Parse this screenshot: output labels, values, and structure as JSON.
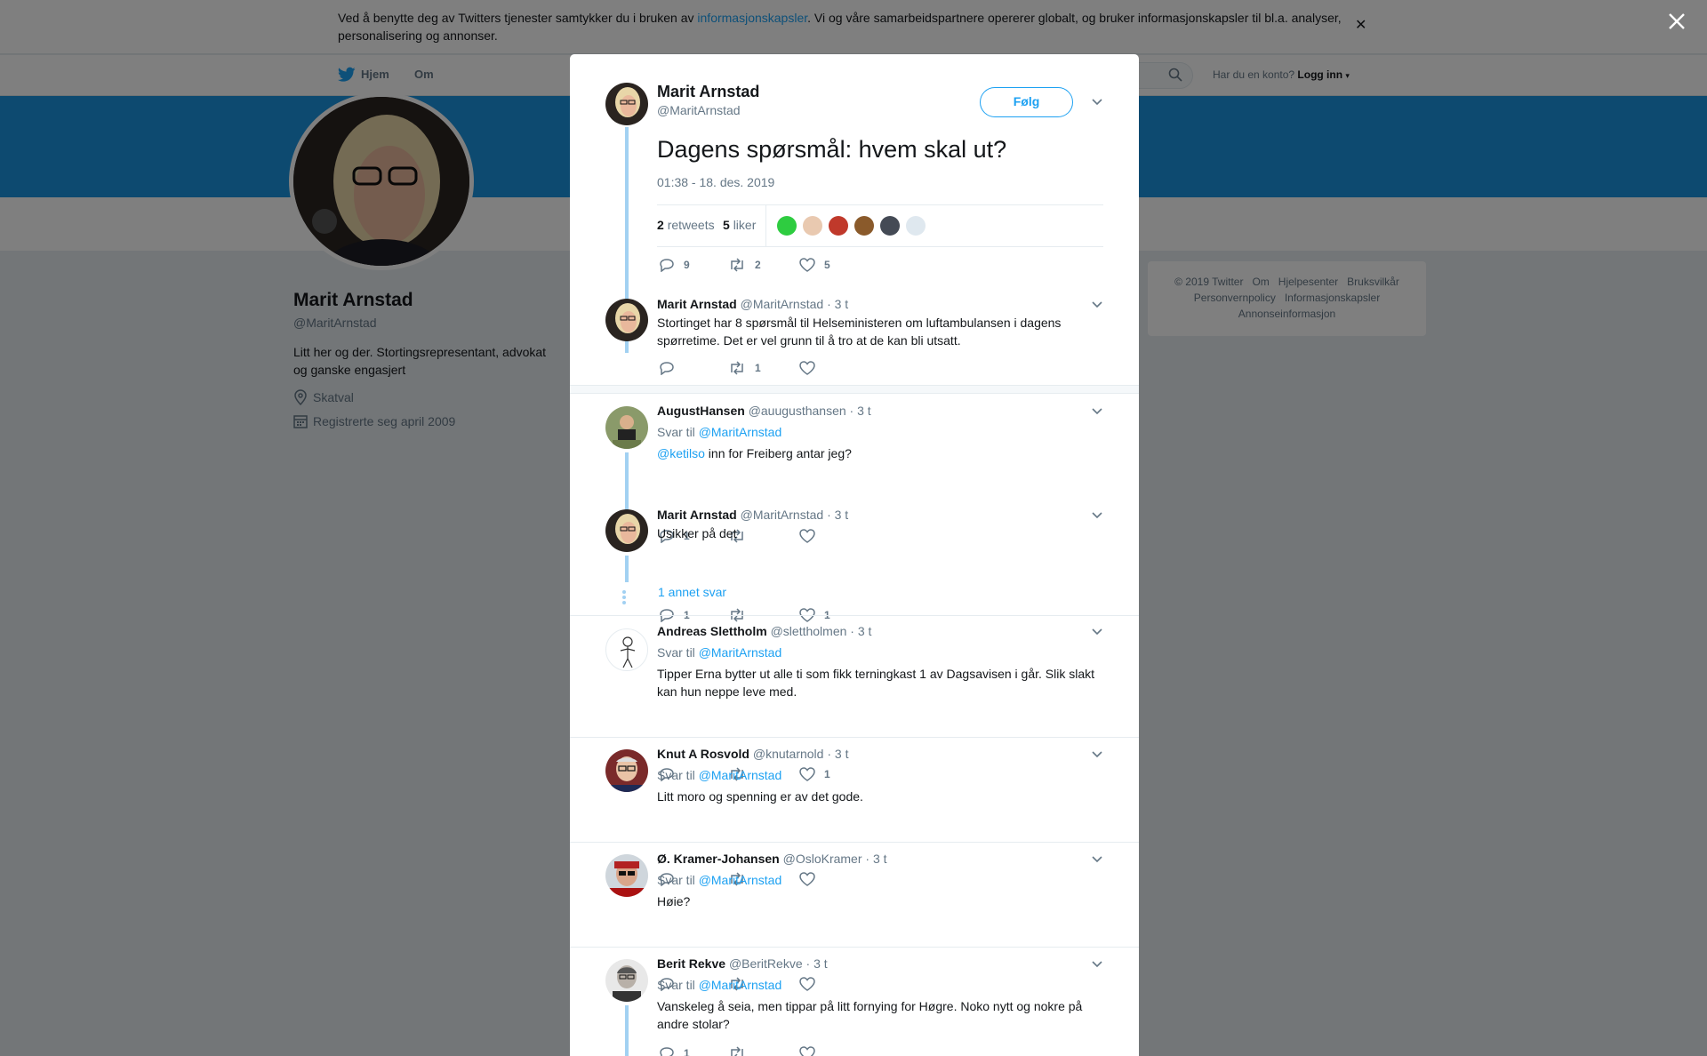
{
  "cookie": {
    "text_before": "Ved å benytte deg av Twitters tjenester samtykker du i bruken av ",
    "link": "informasjonskapsler",
    "text_after": ". Vi og våre samarbeidspartnere opererer globalt, og bruker informasjonskapsler til bl.a. analyser, personalisering og annonser."
  },
  "nav": {
    "home": "Hjem",
    "about": "Om",
    "has_account": "Har du en konto?",
    "login": "Logg inn"
  },
  "profile": {
    "name": "Marit Arnstad",
    "handle": "@MaritArnstad",
    "bio": "Litt her og der. Stortingsrepresentant, advokat og ganske engasjert",
    "location": "Skatval",
    "joined": "Registrerte seg april 2009"
  },
  "footer": {
    "copyright": "© 2019 Twitter",
    "about": "Om",
    "help": "Hjelpesenter",
    "terms": "Bruksvilkår",
    "privacy": "Personvernpolicy",
    "cookies": "Informasjonskapsler",
    "ads": "Annonseinformasjon"
  },
  "main_tweet": {
    "name": "Marit Arnstad",
    "handle": "@MaritArnstad",
    "follow": "Følg",
    "text": "Dagens spørsmål: hvem skal ut?",
    "time": "01:38 - 18. des. 2019",
    "retweets_count": "2",
    "retweets_label": "retweets",
    "likes_count": "5",
    "likes_label": "liker",
    "replies": "9",
    "rts": "2",
    "likes": "5"
  },
  "colors": {
    "accent": "#1da1f2",
    "banner": "#1b95e0",
    "thread_line": "#a2d1f2"
  },
  "replies": [
    {
      "name": "Marit Arnstad",
      "handle": "@MaritArnstad",
      "time": "· 3 t",
      "reply_to_label": "",
      "reply_to": "",
      "mention": "",
      "text": "Stortinget har 8 spørsmål til Helseministeren om luftambulansen i dagens spørretime. Det er vel grunn til å tro at de kan bli utsatt.",
      "replies": "",
      "retweets": "1",
      "likes": ""
    },
    {
      "name": "AugustHansen",
      "handle": "@auugusthansen",
      "time": "· 3 t",
      "reply_to_label": "Svar til",
      "reply_to": "@MaritArnstad",
      "mention": "@ketilso",
      "text": " inn for Freiberg antar jeg?",
      "replies": "1",
      "retweets": "",
      "likes": ""
    },
    {
      "name": "Marit Arnstad",
      "handle": "@MaritArnstad",
      "time": "· 3 t",
      "reply_to_label": "",
      "reply_to": "",
      "mention": "",
      "text": "Usikker på det",
      "replies": "1",
      "retweets": "",
      "likes": "1"
    },
    {
      "name": "Andreas Slettholm",
      "handle": "@slettholmen",
      "time": "· 3 t",
      "reply_to_label": "Svar til",
      "reply_to": "@MaritArnstad",
      "mention": "",
      "text": "Tipper Erna bytter ut alle ti som fikk terningkast 1 av Dagsavisen i går. Slik slakt kan hun neppe leve med.",
      "replies": "",
      "retweets": "",
      "likes": "1"
    },
    {
      "name": "Knut A Rosvold",
      "handle": "@knutarnold",
      "time": "· 3 t",
      "reply_to_label": "Svar til",
      "reply_to": "@MaritArnstad",
      "mention": "",
      "text": "Litt moro og spenning er av det gode.",
      "replies": "",
      "retweets": "",
      "likes": ""
    },
    {
      "name": "Ø. Kramer-Johansen",
      "handle": "@OsloKramer",
      "time": "· 3 t",
      "reply_to_label": "Svar til",
      "reply_to": "@MaritArnstad",
      "mention": "",
      "text": "Høie?",
      "replies": "",
      "retweets": "",
      "likes": ""
    },
    {
      "name": "Berit Rekve",
      "handle": "@BeritRekve",
      "time": "· 3 t",
      "reply_to_label": "Svar til",
      "reply_to": "@MaritArnstad",
      "mention": "",
      "text": "Vanskeleg å seia, men tippar på litt fornying for Høgre. Noko nytt og nokre på andre stolar?",
      "replies": "1",
      "retweets": "",
      "likes": ""
    }
  ],
  "more_replies": "1 annet svar"
}
